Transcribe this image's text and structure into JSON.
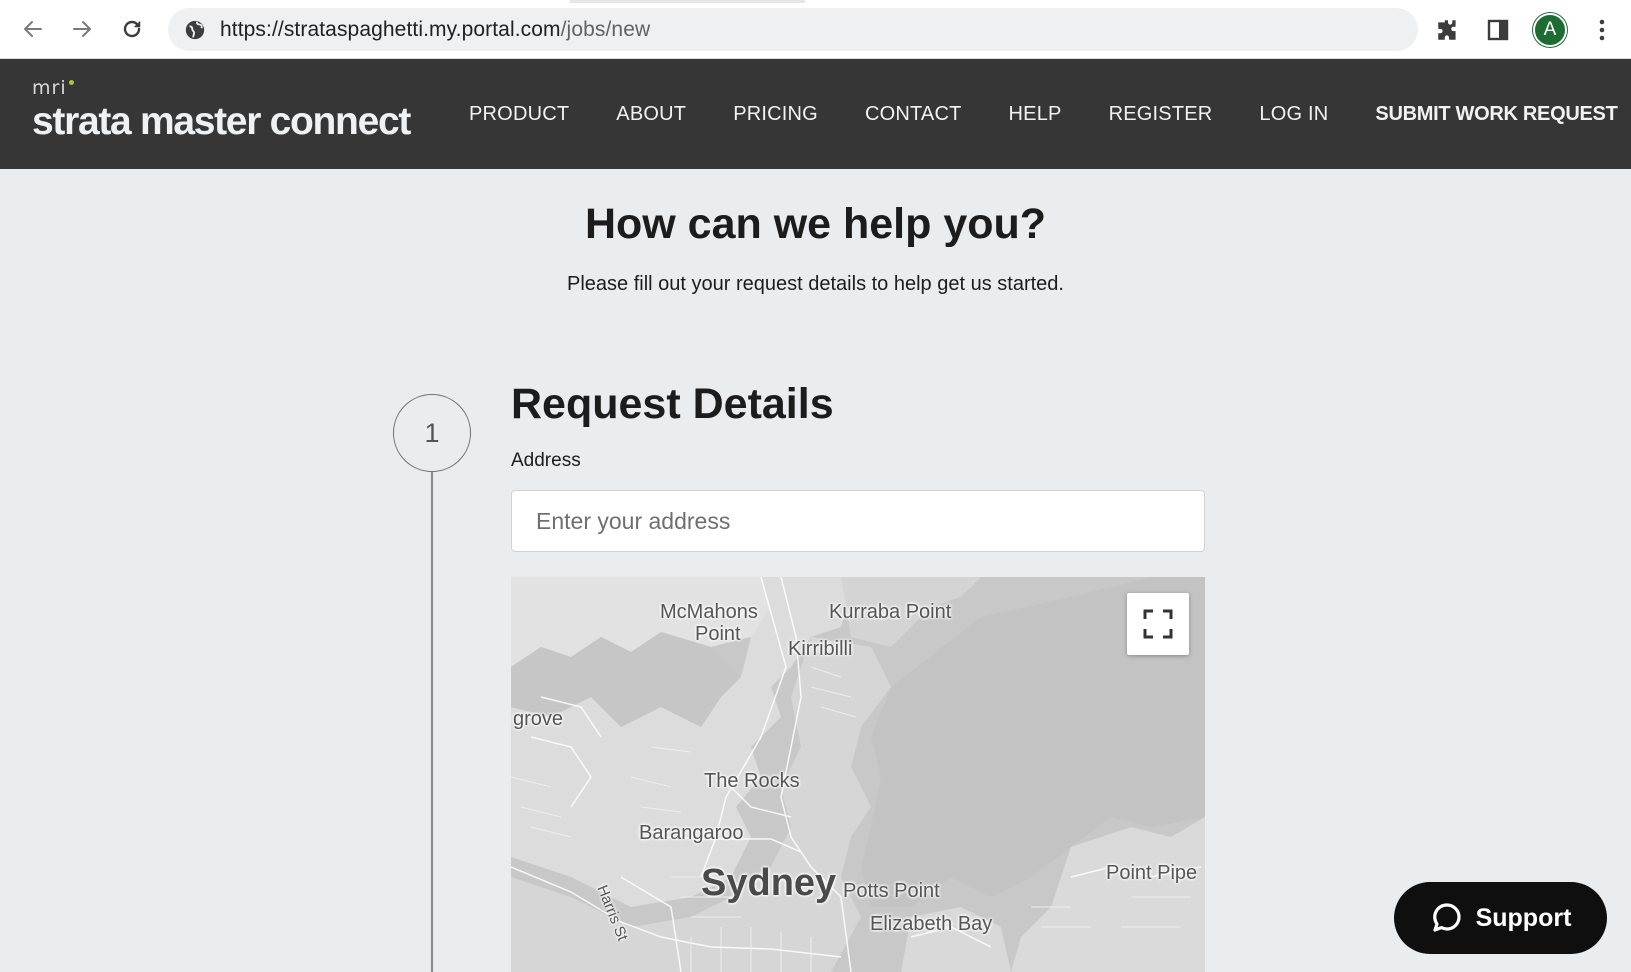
{
  "browser": {
    "url_host": "https://strataspaghetti.my.portal.com",
    "url_path": "/jobs/new",
    "profile_initial": "A"
  },
  "header": {
    "brand_small": "mri",
    "brand_name": "strata master connect",
    "nav": [
      {
        "label": "PRODUCT"
      },
      {
        "label": "ABOUT"
      },
      {
        "label": "PRICING"
      },
      {
        "label": "CONTACT"
      },
      {
        "label": "HELP"
      },
      {
        "label": "REGISTER"
      },
      {
        "label": "LOG IN"
      },
      {
        "label": "SUBMIT WORK REQUEST"
      }
    ]
  },
  "hero": {
    "title": "How can we help you?",
    "subtitle": "Please fill out your request details to help get us started."
  },
  "form": {
    "step_number": "1",
    "section_title": "Request Details",
    "address_label": "Address",
    "address_placeholder": "Enter your address",
    "address_value": ""
  },
  "map": {
    "labels": [
      {
        "text": "McMahons"
      },
      {
        "text": "Point"
      },
      {
        "text": "Kurraba Point"
      },
      {
        "text": "Kirribilli"
      },
      {
        "text": "grove"
      },
      {
        "text": "The Rocks"
      },
      {
        "text": "Barangaroo"
      },
      {
        "text": "Sydney"
      },
      {
        "text": "Potts Point"
      },
      {
        "text": "Elizabeth Bay"
      },
      {
        "text": "Point Pipe"
      },
      {
        "text": "Harris St"
      }
    ]
  },
  "support": {
    "label": "Support"
  },
  "colors": {
    "header_bg": "#363636",
    "page_bg": "#e9edf0",
    "brand_dot": "#a8c536",
    "avatar": "#1e6b34",
    "support_bg": "#0f0f0f"
  }
}
